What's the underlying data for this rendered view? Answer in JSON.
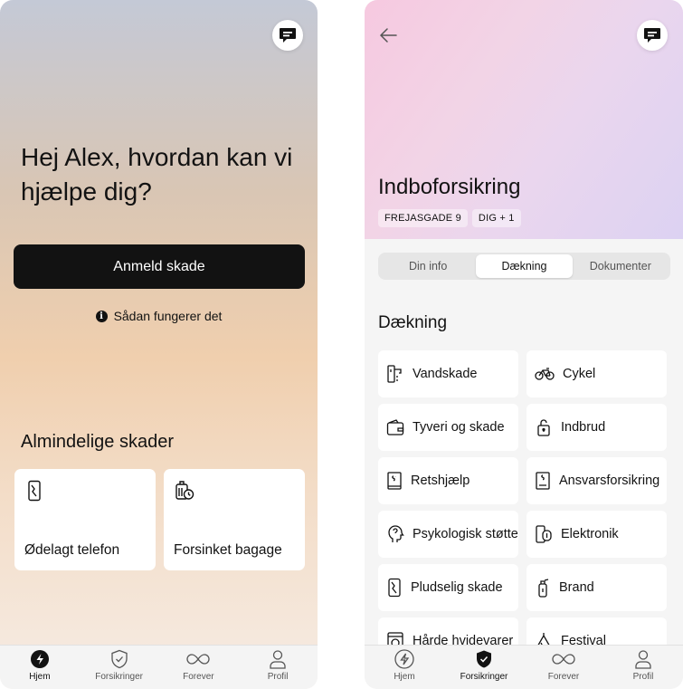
{
  "home": {
    "greeting": "Hej Alex, hvordan kan vi hjælpe dig?",
    "report_button": "Anmeld skade",
    "how_it_works": "Sådan fungerer det",
    "info_glyph": "i",
    "common_damages_title": "Almindelige skader",
    "damage_cards": [
      {
        "label": "Ødelagt telefon",
        "icon": "broken-phone-icon"
      },
      {
        "label": "Forsinket bagage",
        "icon": "luggage-clock-icon"
      }
    ]
  },
  "insurance": {
    "title": "Indboforsikring",
    "tags": [
      "FREJASGADE 9",
      "DIG + 1"
    ],
    "tabs": [
      {
        "label": "Din info",
        "active": false
      },
      {
        "label": "Dækning",
        "active": true
      },
      {
        "label": "Dokumenter",
        "active": false
      }
    ],
    "coverage_title": "Dækning",
    "coverage_items": [
      {
        "label": "Vandskade",
        "icon": "water-tap-icon"
      },
      {
        "label": "Cykel",
        "icon": "bicycle-icon"
      },
      {
        "label": "Tyveri og skade",
        "icon": "wallet-icon"
      },
      {
        "label": "Indbrud",
        "icon": "lock-icon"
      },
      {
        "label": "Retshjælp",
        "icon": "law-book-icon"
      },
      {
        "label": "Ansvarsforsikring",
        "icon": "law-document-icon"
      },
      {
        "label": "Psykologisk støtte",
        "icon": "head-icon"
      },
      {
        "label": "Elektronik",
        "icon": "devices-icon"
      },
      {
        "label": "Pludselig skade",
        "icon": "broken-phone-icon"
      },
      {
        "label": "Brand",
        "icon": "fire-extinguisher-icon"
      },
      {
        "label": "Hårde hvidevarer",
        "icon": "washing-machine-icon"
      },
      {
        "label": "Festival",
        "icon": "tent-icon"
      }
    ]
  },
  "tabbar": {
    "items": [
      {
        "label": "Hjem",
        "icon": "home-icon"
      },
      {
        "label": "Forsikringer",
        "icon": "shield-check-icon"
      },
      {
        "label": "Forever",
        "icon": "infinity-icon"
      },
      {
        "label": "Profil",
        "icon": "person-icon"
      }
    ]
  },
  "colors": {
    "primary": "#121212",
    "card": "#ffffff",
    "hero_pink": "#f6c9e0",
    "hero_lilac": "#dcd2f2",
    "home_peach": "#f0cfae"
  }
}
